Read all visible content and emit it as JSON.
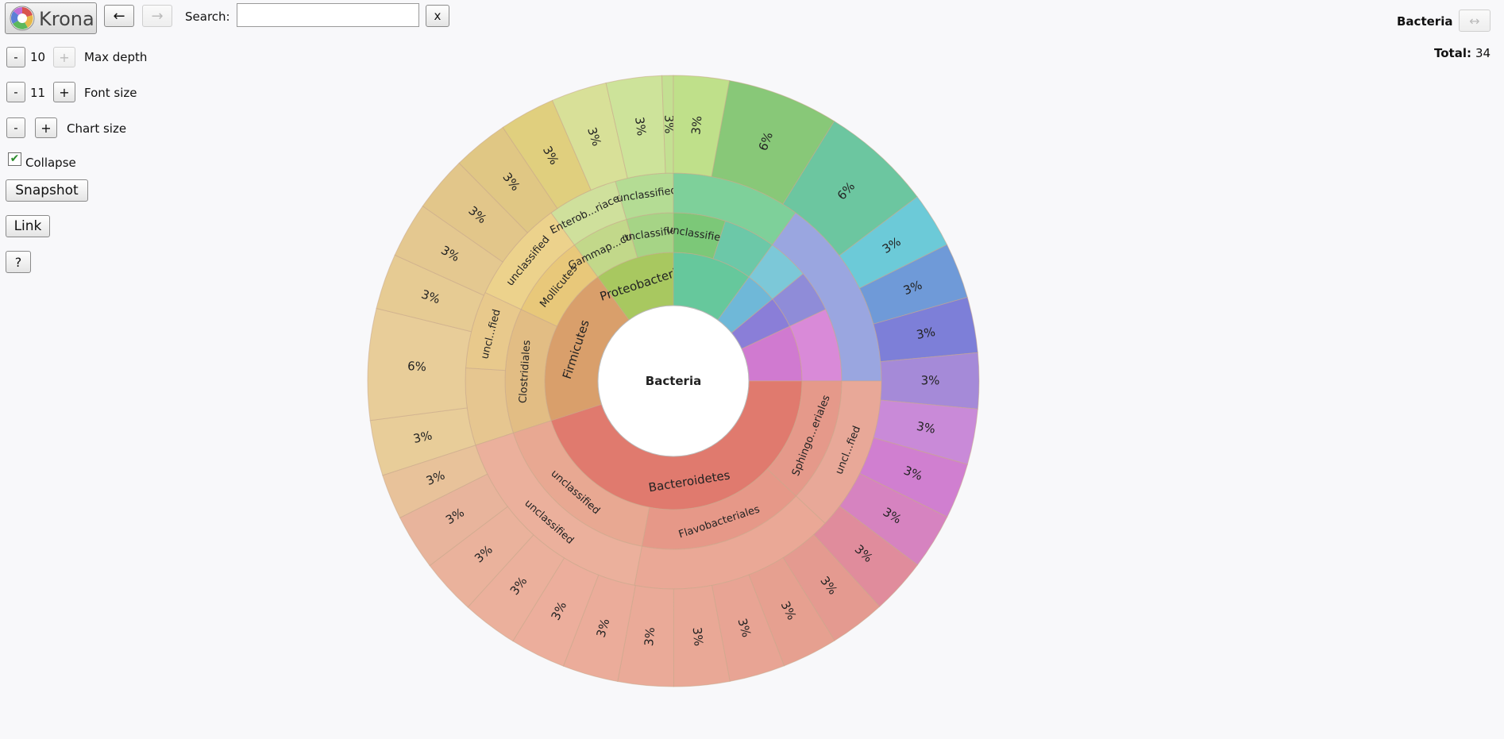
{
  "app": {
    "logo_text": "Krona"
  },
  "toolbar": {
    "back_label": "←",
    "forward_label": "→",
    "search_label": "Search:",
    "search_value": "",
    "clear_label": "x"
  },
  "controls": {
    "max_depth": {
      "minus": "-",
      "value": "10",
      "plus": "+",
      "label": "Max depth"
    },
    "font_size": {
      "minus": "-",
      "value": "11",
      "plus": "+",
      "label": "Font size"
    },
    "chart_size": {
      "minus": "-",
      "plus": "+",
      "label": "Chart size"
    },
    "collapse": {
      "label": "Collapse",
      "checked": true
    },
    "snapshot_label": "Snapshot",
    "link_label": "Link",
    "help_label": "?"
  },
  "details": {
    "name": "Bacteria",
    "total_label": "Total:",
    "total_value": "34",
    "expand_label": "↔"
  },
  "chart_data": {
    "type": "sunburst",
    "center_label": "Bacteria",
    "start_angle_deg": 0,
    "rings": [
      [
        {
          "label": "Firmicutes",
          "start": 0.7,
          "end": 0.9,
          "color": "#d99f6b"
        },
        {
          "label": "Proteobacteria",
          "start": 0.9,
          "end": 1.0,
          "color": "#a8c860"
        },
        {
          "label": "",
          "start": 0.0,
          "end": 0.1,
          "color": "#66c89c"
        },
        {
          "label": "",
          "start": 0.1,
          "end": 0.14,
          "color": "#6fb8d8"
        },
        {
          "label": "",
          "start": 0.14,
          "end": 0.18,
          "color": "#8a7ed8"
        },
        {
          "label": "",
          "start": 0.18,
          "end": 0.25,
          "color": "#d07ad0"
        },
        {
          "label": "Bacteroidetes",
          "start": 0.25,
          "end": 0.7,
          "color": "#e07a6e"
        }
      ],
      [
        {
          "label": "Clostridiales",
          "start": 0.7,
          "end": 0.82,
          "color": "#e2bd84"
        },
        {
          "label": "Mollicutes",
          "start": 0.82,
          "end": 0.9,
          "color": "#e8c87a"
        },
        {
          "label": "Gammap...cteria",
          "start": 0.9,
          "end": 0.955,
          "color": "#c2d88a"
        },
        {
          "label": "unclassified",
          "start": 0.955,
          "end": 1.0,
          "color": "#a6d486"
        },
        {
          "label": "unclassified",
          "start": 0.0,
          "end": 0.05,
          "color": "#7cc878"
        },
        {
          "label": "",
          "start": 0.05,
          "end": 0.1,
          "color": "#6cc8a8"
        },
        {
          "label": "",
          "start": 0.1,
          "end": 0.14,
          "color": "#7cc8d8"
        },
        {
          "label": "",
          "start": 0.14,
          "end": 0.18,
          "color": "#8f8cd8"
        },
        {
          "label": "",
          "start": 0.18,
          "end": 0.25,
          "color": "#d98ad8"
        },
        {
          "label": "Sphingo...eriales",
          "start": 0.25,
          "end": 0.37,
          "color": "#e5998a"
        },
        {
          "label": "Flavobacteriales",
          "start": 0.37,
          "end": 0.53,
          "color": "#e69888"
        },
        {
          "label": "unclassified",
          "start": 0.53,
          "end": 0.7,
          "color": "#e8a892"
        }
      ],
      [
        {
          "label": "",
          "start": 0.7,
          "end": 0.76,
          "color": "#e6c690"
        },
        {
          "label": "uncl...fied",
          "start": 0.76,
          "end": 0.82,
          "color": "#e8c98c"
        },
        {
          "label": "unclassified",
          "start": 0.82,
          "end": 0.9,
          "color": "#ecd28c"
        },
        {
          "label": "Enterob...riaceae",
          "start": 0.9,
          "end": 0.955,
          "color": "#cfe09c"
        },
        {
          "label": "unclassified",
          "start": 0.955,
          "end": 1.0,
          "color": "#b4dc94"
        },
        {
          "label": "",
          "start": 0.0,
          "end": 0.1,
          "color": "#7ed09a"
        },
        {
          "label": "",
          "start": 0.1,
          "end": 0.25,
          "color": "#9aa6e0"
        },
        {
          "label": "uncl...fied",
          "start": 0.25,
          "end": 0.37,
          "color": "#e8a898"
        },
        {
          "label": "",
          "start": 0.37,
          "end": 0.53,
          "color": "#eaa896"
        },
        {
          "label": "unclassified",
          "start": 0.53,
          "end": 0.7,
          "color": "#ebb09c"
        }
      ],
      [
        {
          "label": "3%",
          "start": 0.7,
          "end": 0.7294,
          "color": "#e8cd99"
        },
        {
          "label": "6%",
          "start": 0.7294,
          "end": 0.7882,
          "color": "#e8cd99"
        },
        {
          "label": "3%",
          "start": 0.7882,
          "end": 0.8176,
          "color": "#e6cb93"
        },
        {
          "label": "3%",
          "start": 0.8176,
          "end": 0.847,
          "color": "#e4c890"
        },
        {
          "label": "3%",
          "start": 0.847,
          "end": 0.8764,
          "color": "#e2c68a"
        },
        {
          "label": "3%",
          "start": 0.8764,
          "end": 0.9058,
          "color": "#e0c784"
        },
        {
          "label": "3%",
          "start": 0.9058,
          "end": 0.9352,
          "color": "#e0cf7e"
        },
        {
          "label": "3%",
          "start": 0.9352,
          "end": 0.9646,
          "color": "#d8e098"
        },
        {
          "label": "3%",
          "start": 0.9646,
          "end": 0.994,
          "color": "#cde39a"
        },
        {
          "label": "3%",
          "start": 0.994,
          "end": 1.0,
          "color": "#c3e092"
        },
        {
          "label": "3%",
          "start": 0.0,
          "end": 0.0294,
          "color": "#bfe08a"
        },
        {
          "label": "6%",
          "start": 0.0294,
          "end": 0.0882,
          "color": "#88c878"
        },
        {
          "label": "6%",
          "start": 0.0882,
          "end": 0.147,
          "color": "#6cc6a0"
        },
        {
          "label": "3%",
          "start": 0.147,
          "end": 0.1764,
          "color": "#6ccad8"
        },
        {
          "label": "3%",
          "start": 0.1764,
          "end": 0.2058,
          "color": "#6f9ad8"
        },
        {
          "label": "3%",
          "start": 0.2058,
          "end": 0.2352,
          "color": "#7d7fd8"
        },
        {
          "label": "3%",
          "start": 0.2352,
          "end": 0.2646,
          "color": "#a58ad8"
        },
        {
          "label": "3%",
          "start": 0.2646,
          "end": 0.294,
          "color": "#c98ad8"
        },
        {
          "label": "3%",
          "start": 0.294,
          "end": 0.3234,
          "color": "#d07fd0"
        },
        {
          "label": "3%",
          "start": 0.3234,
          "end": 0.3528,
          "color": "#d683c0"
        },
        {
          "label": "3%",
          "start": 0.3528,
          "end": 0.3822,
          "color": "#e08c9c"
        },
        {
          "label": "3%",
          "start": 0.3822,
          "end": 0.4116,
          "color": "#e49a90"
        },
        {
          "label": "3%",
          "start": 0.4116,
          "end": 0.441,
          "color": "#e6a090"
        },
        {
          "label": "3%",
          "start": 0.441,
          "end": 0.4704,
          "color": "#e8a494"
        },
        {
          "label": "3%",
          "start": 0.4704,
          "end": 0.4998,
          "color": "#e9a896"
        },
        {
          "label": "3%",
          "start": 0.4998,
          "end": 0.5292,
          "color": "#eaaa98"
        },
        {
          "label": "3%",
          "start": 0.5292,
          "end": 0.5586,
          "color": "#ebac9a"
        },
        {
          "label": "3%",
          "start": 0.5586,
          "end": 0.588,
          "color": "#ecae9c"
        },
        {
          "label": "3%",
          "start": 0.588,
          "end": 0.6174,
          "color": "#ebb09c"
        },
        {
          "label": "3%",
          "start": 0.6174,
          "end": 0.6468,
          "color": "#eab29c"
        },
        {
          "label": "3%",
          "start": 0.6468,
          "end": 0.6762,
          "color": "#e8b49c"
        },
        {
          "label": "3%",
          "start": 0.6762,
          "end": 0.7,
          "color": "#e8c29a"
        }
      ]
    ]
  }
}
